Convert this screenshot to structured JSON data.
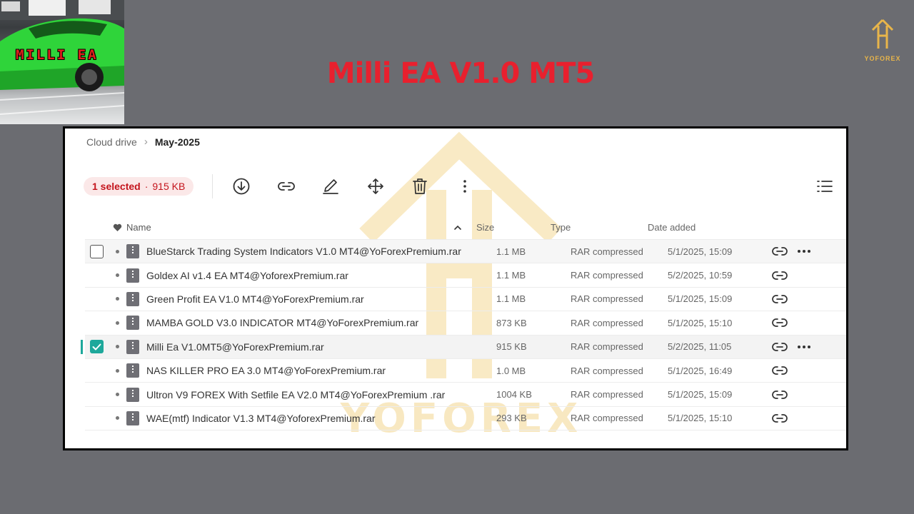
{
  "thumbnail": {
    "text": "MILLI EA"
  },
  "brand": {
    "name": "YOFOREX",
    "color": "#e8b54a"
  },
  "headline": "Milli EA V1.0 MT5",
  "breadcrumb": {
    "root": "Cloud drive",
    "current": "May-2025"
  },
  "selection": {
    "count_label": "1 selected",
    "dot": "·",
    "size": "915 KB"
  },
  "toolbar": {
    "icons": [
      "download-icon",
      "link-icon",
      "rename-icon",
      "move-icon",
      "trash-icon",
      "more-vertical-icon"
    ],
    "view_icon": "list-view-icon"
  },
  "table": {
    "headers": {
      "name": "Name",
      "size": "Size",
      "type": "Type",
      "date": "Date added"
    },
    "rows": [
      {
        "name": "BlueStarck Trading System Indicators V1.0 MT4@YoForexPremium.rar",
        "size": "1.1 MB",
        "type": "RAR compressed",
        "date": "5/1/2025, 15:09"
      },
      {
        "name": "Goldex AI v1.4 EA MT4@YoforexPremium.rar",
        "size": "1.1 MB",
        "type": "RAR compressed",
        "date": "5/2/2025, 10:59"
      },
      {
        "name": "Green Profit EA V1.0 MT4@YoForexPremium.rar",
        "size": "1.1 MB",
        "type": "RAR compressed",
        "date": "5/1/2025, 15:09"
      },
      {
        "name": "MAMBA GOLD V3.0 INDICATOR MT4@YoForexPremium.rar",
        "size": "873 KB",
        "type": "RAR compressed",
        "date": "5/1/2025, 15:10"
      },
      {
        "name": "Milli Ea V1.0MT5@YoForexPremium.rar",
        "size": "915 KB",
        "type": "RAR compressed",
        "date": "5/2/2025, 11:05"
      },
      {
        "name": "NAS KILLER PRO EA 3.0 MT4@YoForexPremium.rar",
        "size": "1.0 MB",
        "type": "RAR compressed",
        "date": "5/1/2025, 16:49"
      },
      {
        "name": "Ultron V9 FOREX With Setfile EA V2.0 MT4@YoForexPremium .rar",
        "size": "1004 KB",
        "type": "RAR compressed",
        "date": "5/1/2025, 15:09"
      },
      {
        "name": "WAE(mtf) Indicator V1.3 MT4@YoforexPremium.rar",
        "size": "293 KB",
        "type": "RAR compressed",
        "date": "5/1/2025, 15:10"
      }
    ]
  },
  "watermark": {
    "text": "YOFOREX"
  },
  "colors": {
    "accent": "#1ea89b",
    "selection": "#c4141c",
    "headline": "#e8202e"
  }
}
